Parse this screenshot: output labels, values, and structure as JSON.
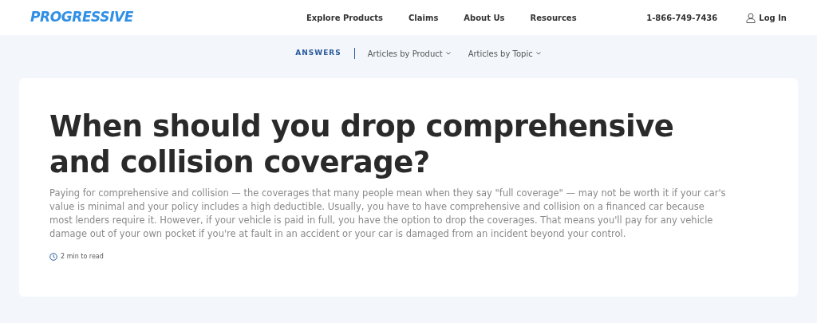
{
  "header": {
    "logo": "PROGRESSIVE",
    "nav": [
      "Explore Products",
      "Claims",
      "About Us",
      "Resources"
    ],
    "phone": "1-866-749-7436",
    "login": "Log In"
  },
  "subnav": {
    "section": "ANSWERS",
    "menus": [
      "Articles by Product",
      "Articles by Topic"
    ]
  },
  "article": {
    "title": "When should you drop comprehensive and collision coverage?",
    "summary": "Paying for comprehensive and collision — the coverages that many people mean when they say \"full coverage\" — may not be worth it if your car's value is minimal and your policy includes a high deductible. Usually, you have to have comprehensive and collision on a financed car because most lenders require it. However, if your vehicle is paid in full, you have the option to drop the coverages. That means you'll pay for any vehicle damage out of your own pocket if you're at fault in an accident or your car is damaged from an incident beyond your control.",
    "read_time": "2 min to read"
  }
}
